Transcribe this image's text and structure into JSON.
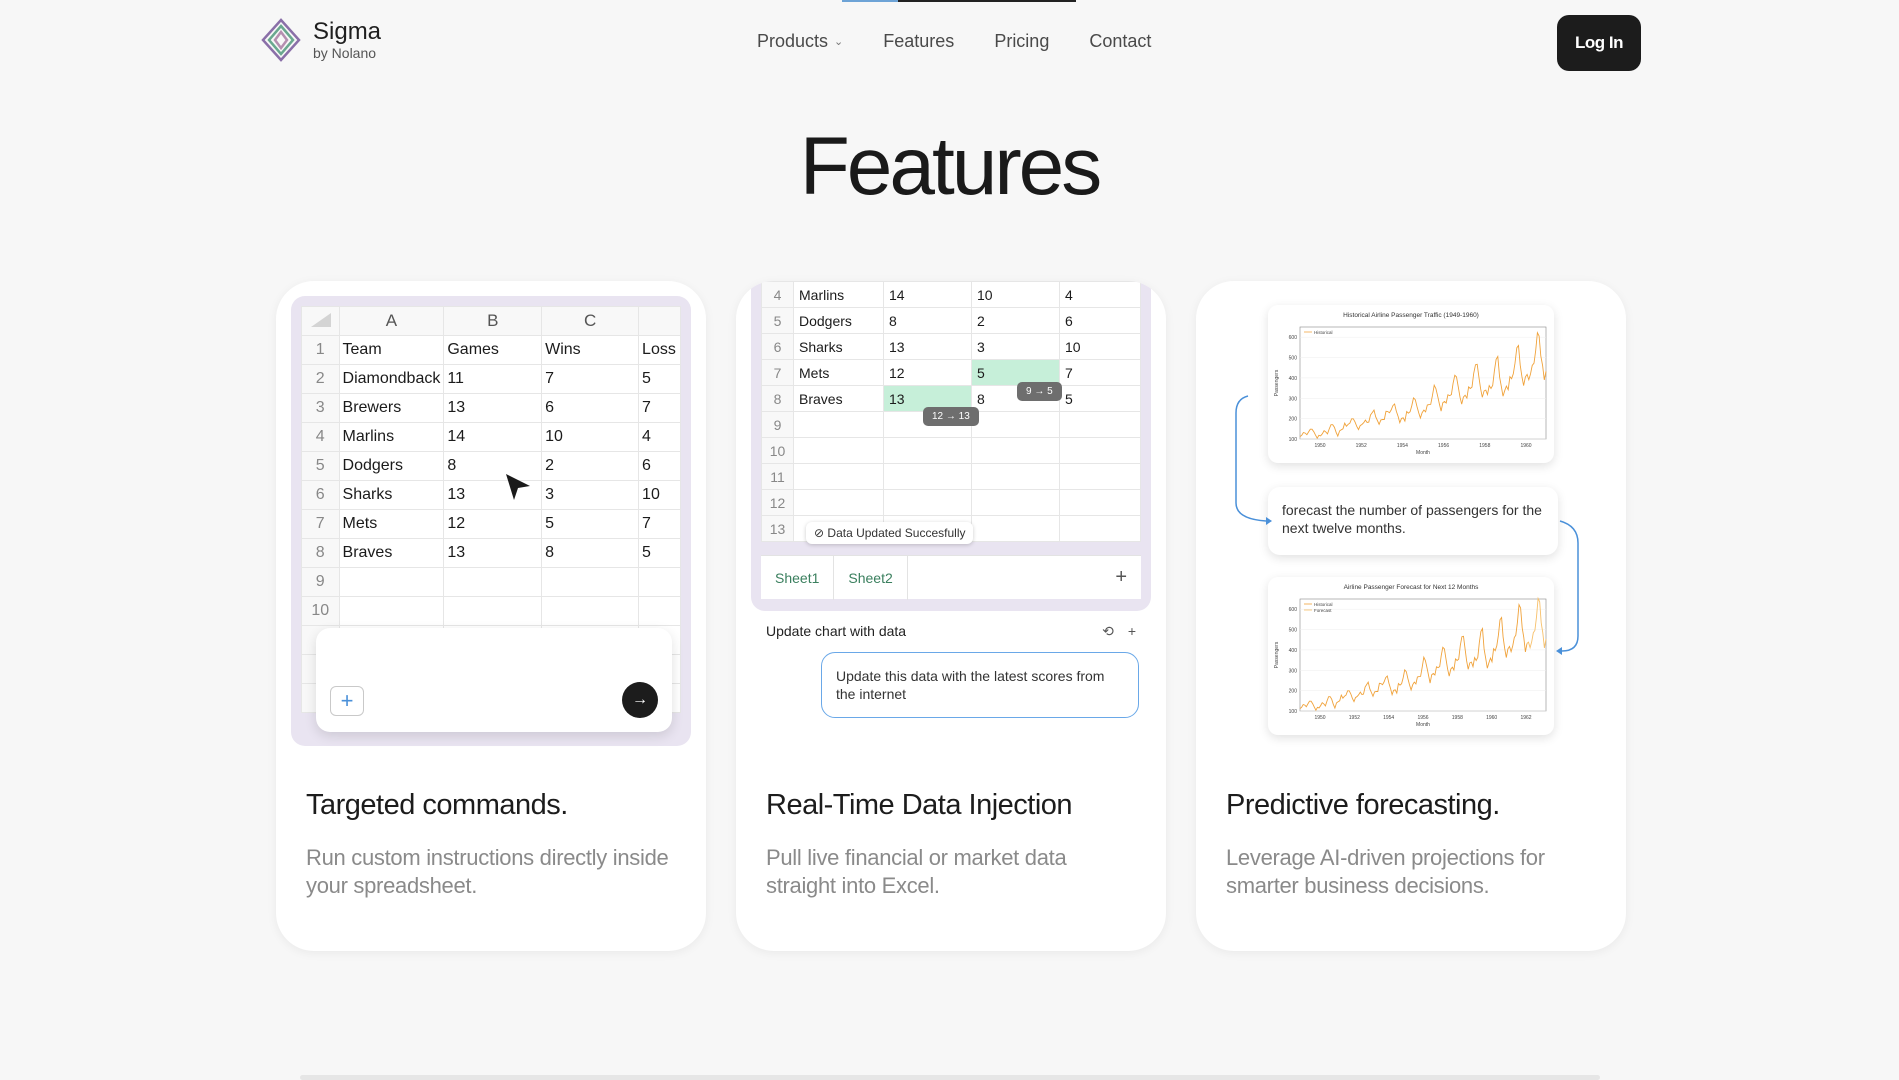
{
  "brand": {
    "name": "Sigma",
    "sub": "by Nolano"
  },
  "nav": {
    "products": "Products",
    "features": "Features",
    "pricing": "Pricing",
    "contact": "Contact"
  },
  "login": "Log In",
  "title": "Features",
  "card1": {
    "heading": "Targeted commands.",
    "desc": "Run custom instructions directly inside your spreadsheet.",
    "cols": [
      "A",
      "B",
      "C"
    ],
    "header": [
      "Team",
      "Games",
      "Wins",
      "Loss"
    ],
    "rows": [
      [
        "2",
        "Diamondback",
        "11",
        "7",
        "5"
      ],
      [
        "3",
        "Brewers",
        "13",
        "6",
        "7"
      ],
      [
        "4",
        "Marlins",
        "14",
        "10",
        "4"
      ],
      [
        "5",
        "Dodgers",
        "8",
        "2",
        "6"
      ],
      [
        "6",
        "Sharks",
        "13",
        "3",
        "10"
      ],
      [
        "7",
        "Mets",
        "12",
        "5",
        "7"
      ],
      [
        "8",
        "Braves",
        "13",
        "8",
        "5"
      ]
    ],
    "plus": "+",
    "send": "→"
  },
  "card2": {
    "heading": "Real-Time Data Injection",
    "desc": "Pull live financial or market data straight into Excel.",
    "rows": [
      [
        "4",
        "Marlins",
        "14",
        "10",
        "4"
      ],
      [
        "5",
        "Dodgers",
        "8",
        "2",
        "6"
      ],
      [
        "6",
        "Sharks",
        "13",
        "3",
        "10"
      ],
      [
        "7",
        "Mets",
        "12",
        "5",
        "7"
      ],
      [
        "8",
        "Braves",
        "13",
        "8",
        "5"
      ]
    ],
    "chip1": "12 → 13",
    "chip2": "9 → 5",
    "toast": "Data Updated Succesfully",
    "tab1": "Sheet1",
    "tab2": "Sheet2",
    "tab_add": "+",
    "chat_title": "Update chart with data",
    "chat_history": "⟲",
    "chat_add": "+",
    "bubble": "Update this data with the latest scores from the internet"
  },
  "card3": {
    "heading": "Predictive forecasting.",
    "desc": "Leverage AI-driven projections for smarter business decisions.",
    "bubble": "forecast the number of passengers for the next twelve months."
  },
  "chart_data": [
    {
      "type": "line",
      "title": "Historical Airline Passenger Traffic (1949-1960)",
      "xlabel": "Month",
      "ylabel": "Passengers",
      "legend": [
        "Historical"
      ],
      "xticks": [
        "1950",
        "1952",
        "1954",
        "1956",
        "1958",
        "1960"
      ],
      "yticks": [
        "100",
        "200",
        "300",
        "400",
        "500",
        "600"
      ],
      "ylim": [
        100,
        650
      ],
      "values": [
        112,
        118,
        132,
        129,
        121,
        135,
        148,
        148,
        136,
        119,
        104,
        118,
        115,
        126,
        141,
        135,
        125,
        149,
        170,
        170,
        158,
        133,
        114,
        140,
        145,
        150,
        178,
        163,
        172,
        178,
        199,
        199,
        184,
        162,
        146,
        166,
        171,
        180,
        193,
        181,
        183,
        218,
        230,
        242,
        209,
        191,
        172,
        194,
        196,
        196,
        236,
        235,
        229,
        243,
        264,
        272,
        237,
        211,
        180,
        201,
        204,
        188,
        235,
        227,
        234,
        264,
        302,
        293,
        259,
        229,
        203,
        229,
        242,
        233,
        267,
        269,
        270,
        315,
        364,
        347,
        312,
        274,
        237,
        278,
        284,
        277,
        317,
        313,
        318,
        374,
        413,
        405,
        355,
        306,
        271,
        306,
        315,
        301,
        356,
        348,
        355,
        422,
        465,
        467,
        404,
        347,
        305,
        336,
        340,
        318,
        362,
        348,
        363,
        435,
        491,
        505,
        404,
        359,
        310,
        337,
        360,
        342,
        406,
        396,
        420,
        472,
        548,
        559,
        463,
        407,
        362,
        405,
        417,
        391,
        419,
        461,
        472,
        535,
        622,
        606,
        508,
        461,
        390,
        432
      ]
    },
    {
      "type": "line",
      "title": "Airline Passenger Forecast for Next 12 Months",
      "xlabel": "Month",
      "ylabel": "Passengers",
      "legend": [
        "Historical",
        "Forecast"
      ],
      "xticks": [
        "1950",
        "1952",
        "1954",
        "1956",
        "1958",
        "1960",
        "1962"
      ],
      "yticks": [
        "100",
        "200",
        "300",
        "400",
        "500",
        "600"
      ],
      "ylim": [
        100,
        650
      ]
    }
  ]
}
